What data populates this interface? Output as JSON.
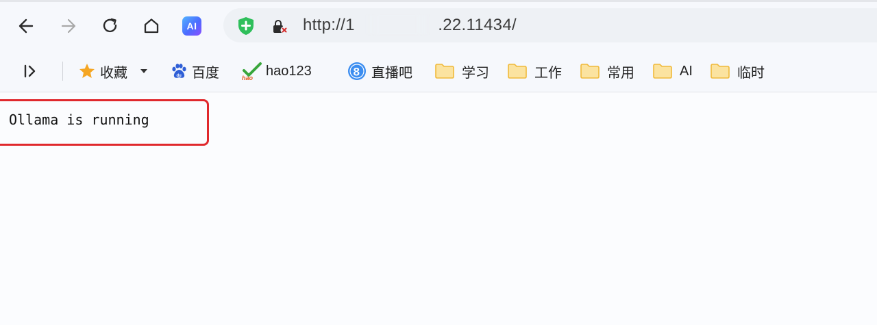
{
  "browser": {
    "url": "http://1     .22.11434/",
    "ai_label": "AI"
  },
  "bookmarks": {
    "items": [
      {
        "label": "收藏",
        "icon": "star-icon"
      },
      {
        "label": "百度",
        "icon": "baidu-paw-icon"
      },
      {
        "label": "hao123",
        "icon": "hao123-check-icon"
      },
      {
        "label": "直播吧",
        "icon": "zhibo8-icon"
      },
      {
        "label": "学习",
        "icon": "folder-icon"
      },
      {
        "label": "工作",
        "icon": "folder-icon"
      },
      {
        "label": "常用",
        "icon": "folder-icon"
      },
      {
        "label": "AI",
        "icon": "folder-icon"
      },
      {
        "label": "临时",
        "icon": "folder-icon"
      }
    ]
  },
  "page": {
    "body_text": "Ollama is running"
  },
  "colors": {
    "highlight_border": "#e0282c",
    "shield_green": "#2fbf5b",
    "folder_yellow": "#f3c24a",
    "star_orange": "#f5a623"
  }
}
